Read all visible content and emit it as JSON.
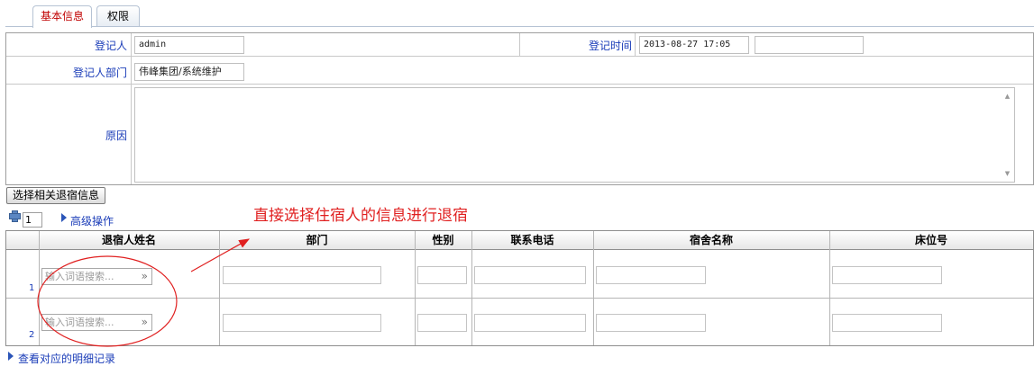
{
  "tabs": [
    {
      "label": "基本信息",
      "active": true
    },
    {
      "label": "权限",
      "active": false
    }
  ],
  "form": {
    "registrant_label": "登记人",
    "registrant_value": "admin",
    "reg_time_label": "登记时间",
    "reg_time_value": "2013-08-27 17:05",
    "reg_time_extra_value": "",
    "dept_label": "登记人部门",
    "dept_value": "伟峰集团/系统维护",
    "reason_label": "原因",
    "reason_value": ""
  },
  "select_button_label": "选择相关退宿信息",
  "row_count_value": "1",
  "advanced_link": "高级操作",
  "annotation": "直接选择住宿人的信息进行退宿",
  "grid": {
    "columns": [
      "退宿人姓名",
      "部门",
      "性别",
      "联系电话",
      "宿舍名称",
      "床位号"
    ],
    "rows": [
      {
        "num": "1",
        "search_placeholder": "输入词语搜索...",
        "search_icon": "»"
      },
      {
        "num": "2",
        "search_placeholder": "输入词语搜索...",
        "search_icon": "»"
      }
    ]
  },
  "detail_link": "查看对应的明细记录",
  "colors": {
    "accent_red": "#e02020",
    "link_blue": "#1a3cb8"
  }
}
